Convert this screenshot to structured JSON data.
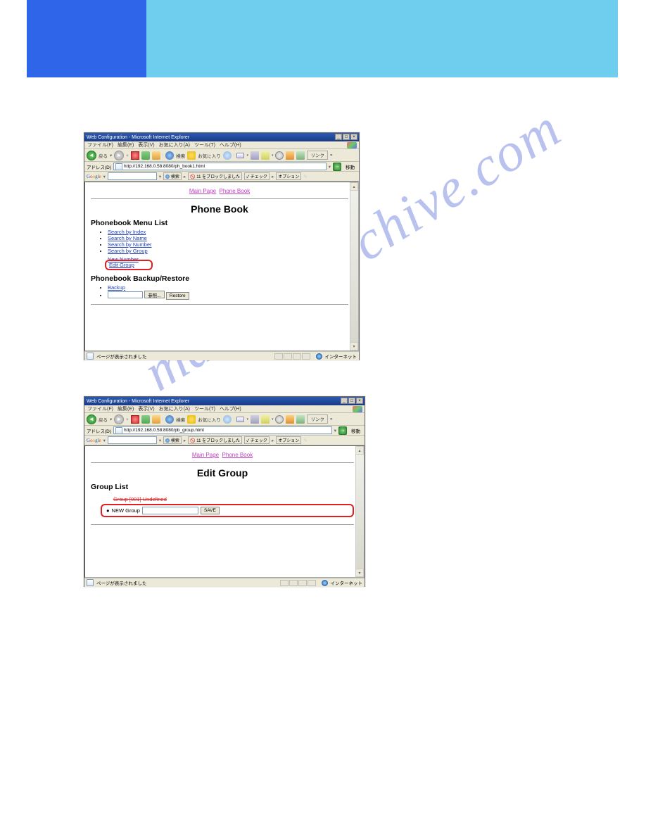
{
  "watermark": "manualsarchive.com",
  "ie": {
    "window_title": "Web Configuration - Microsoft Internet Explorer",
    "menu": {
      "file": "ファイル(F)",
      "edit": "編集(E)",
      "view": "表示(V)",
      "favorites": "お気に入り(A)",
      "tools": "ツール(T)",
      "help": "ヘルプ(H)"
    },
    "toolbar": {
      "back": "戻る",
      "search": "検索",
      "favorites": "お気に入り",
      "links": "リンク"
    },
    "addr_label": "アドレス(D)",
    "addr1": "http://192.168.0.58:8080/ph_book1.html",
    "addr2": "http://192.168.0.58:8080/pb_group.html",
    "go": "移動",
    "google": {
      "label": "Google",
      "search_btn": "検索",
      "blocked": "11 をブロックしました",
      "check": "チェック",
      "option": "オプション"
    },
    "status_text": "ページが表示されました",
    "status_zone": "インターネット"
  },
  "phonebook": {
    "top_main": "Main Page",
    "top_pb": "Phone Book",
    "title": "Phone Book",
    "menu_heading": "Phonebook Menu List",
    "search_index": "Search by Index",
    "search_name": "Search by Name",
    "search_number": "Search by Number",
    "search_group": "Search by Group",
    "new_number": "New Number",
    "edit_group": "Edit Group",
    "backup_heading": "Phonebook Backup/Restore",
    "backup_link": "Backup",
    "browse_btn": "参照...",
    "restore_btn": "Restore"
  },
  "editgroup": {
    "top_main": "Main Page",
    "top_pb": "Phone Book",
    "title": "Edit Group",
    "list_heading": "Group List",
    "group_entry": "Group [001] Undefined",
    "new_group_label": "NEW Group",
    "save_btn": "SAVE"
  }
}
